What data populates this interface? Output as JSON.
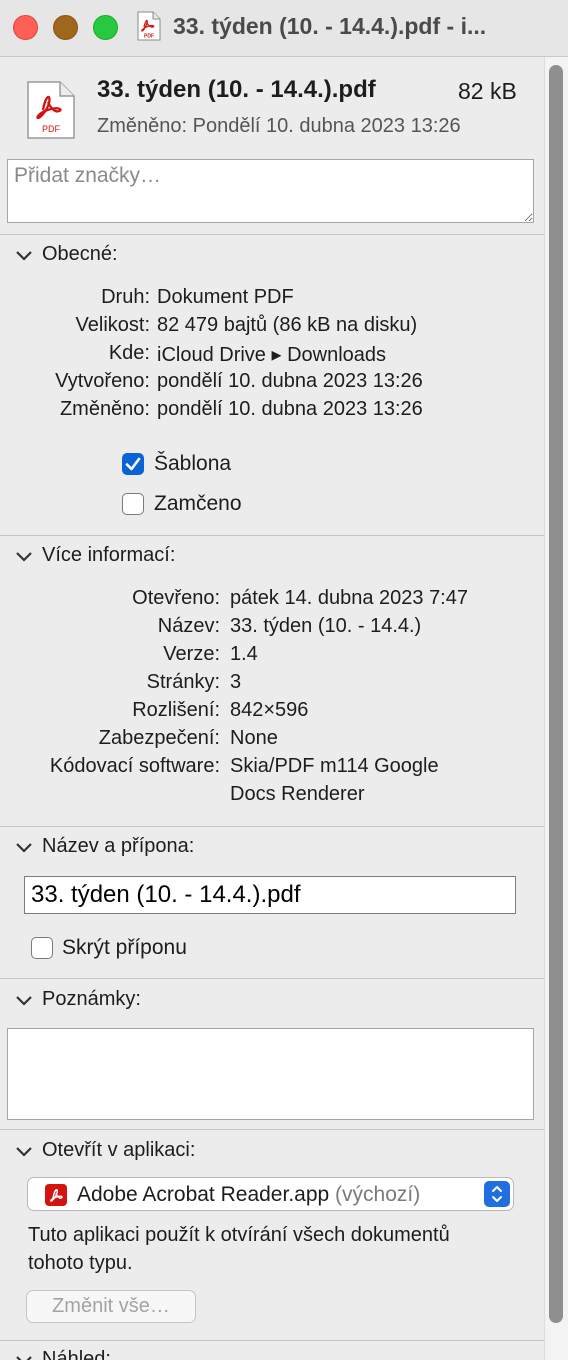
{
  "window": {
    "title": "33. týden (10. - 14.4.).pdf - i..."
  },
  "header": {
    "file_name": "33. týden (10. - 14.4.).pdf",
    "file_size": "82 kB",
    "modified": "Změněno: Pondělí 10. dubna 2023 13:26",
    "icon_label": "PDF"
  },
  "tags": {
    "placeholder": "Přidat značky…"
  },
  "general": {
    "title": "Obecné:",
    "rows": [
      {
        "label": "Druh:",
        "value": "Dokument PDF"
      },
      {
        "label": "Velikost:",
        "value": "82 479 bajtů (86 kB na disku)"
      },
      {
        "label": "Kde:",
        "value": "iCloud Drive ▸ Downloads"
      },
      {
        "label": "Vytvořeno:",
        "value": "pondělí 10. dubna 2023 13:26"
      },
      {
        "label": "Změněno:",
        "value": "pondělí 10. dubna 2023 13:26"
      }
    ],
    "template_label": "Šablona",
    "template_checked": true,
    "locked_label": "Zamčeno",
    "locked_checked": false
  },
  "more_info": {
    "title": "Více informací:",
    "rows": [
      {
        "label": "Otevřeno:",
        "value": "pátek 14. dubna 2023 7:47"
      },
      {
        "label": "Název:",
        "value": "33. týden (10. - 14.4.)"
      },
      {
        "label": "Verze:",
        "value": "1.4"
      },
      {
        "label": "Stránky:",
        "value": "3"
      },
      {
        "label": "Rozlišení:",
        "value": "842×596"
      },
      {
        "label": "Zabezpečení:",
        "value": "None"
      },
      {
        "label": "Kódovací software:",
        "value": "Skia/PDF m114 Google"
      }
    ],
    "software_line2": "Docs Renderer"
  },
  "name_ext": {
    "title": "Název a přípona:",
    "value": "33. týden (10. - 14.4.).pdf",
    "hide_ext_label": "Skrýt příponu",
    "hide_ext_checked": false
  },
  "notes": {
    "title": "Poznámky:"
  },
  "open_with": {
    "title": "Otevřít v aplikaci:",
    "app": "Adobe Acrobat Reader.app",
    "app_default": "(výchozí)",
    "description": "Tuto aplikaci použít k otvírání všech dokumentů tohoto typu.",
    "change_all": "Změnit vše…"
  },
  "preview": {
    "title": "Náhled:"
  },
  "colors": {
    "accent": "#0a63d6",
    "pdf_red": "#d3130f",
    "window_bg": "#ececec"
  }
}
